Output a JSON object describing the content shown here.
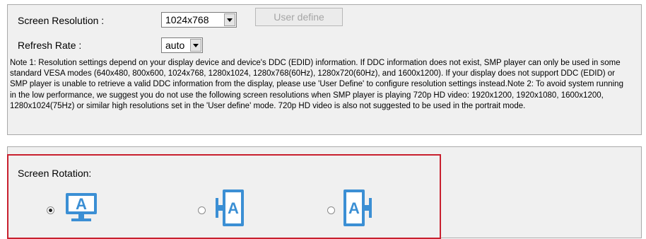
{
  "resolution": {
    "label": "Screen Resolution :",
    "selected": "1024x768",
    "user_define_button": "User define"
  },
  "refresh": {
    "label": "Refresh Rate :",
    "selected": "auto"
  },
  "note_text": "Note 1: Resolution settings depend on your display device and device's DDC (EDID) information. If DDC information does not exist, SMP player can only be used in some standard VESA modes (640x480, 800x600, 1024x768, 1280x1024, 1280x768(60Hz), 1280x720(60Hz), and 1600x1200). If your display does not support DDC (EDID) or SMP player is unable to retrieve a valid DDC information from the display, please use 'User Define' to configure resolution settings instead.Note 2: To avoid system running in the low performance, we suggest you do not use the following screen resolutions when SMP player is playing 720p HD video: 1920x1200, 1920x1080, 1600x1200, 1280x1024(75Hz) or similar high resolutions set in the 'User define' mode. 720p HD video is also not suggested to be used in the portrait mode.",
  "rotation": {
    "label": "Screen Rotation:",
    "options": [
      {
        "icon": "landscape-monitor-icon",
        "selected": true
      },
      {
        "icon": "portrait-left-monitor-icon",
        "selected": false
      },
      {
        "icon": "portrait-right-monitor-icon",
        "selected": false
      }
    ]
  },
  "colors": {
    "highlight_border": "#c8202e",
    "icon_blue": "#3b8fd4",
    "panel_bg": "#f0f0f0"
  }
}
